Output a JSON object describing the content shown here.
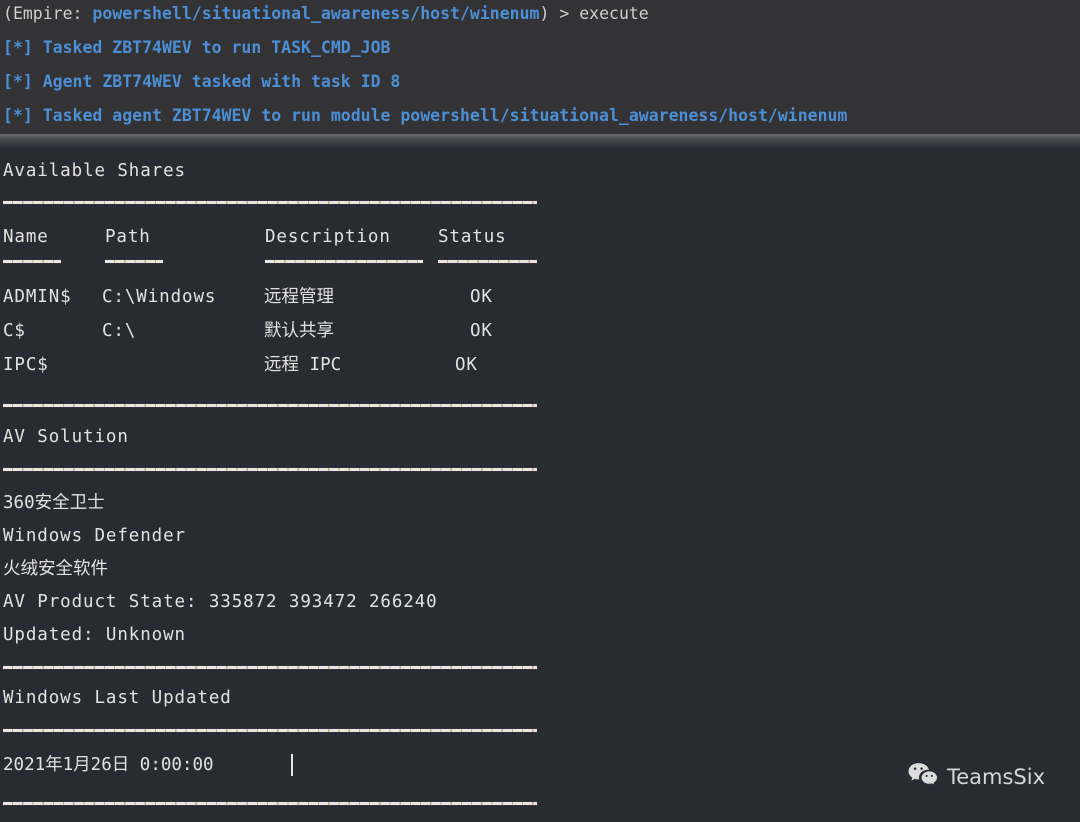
{
  "theme": {
    "header_bg": "#333335",
    "body_bg": "#292b33",
    "text": "#e3e2df",
    "accent_blue": "#4d8fd6",
    "rule": "#e8e6e2"
  },
  "console": {
    "prompt": {
      "open_paren": "(",
      "label": "Empire: ",
      "module_path": "powershell/situational_awareness/host/winenum",
      "close_paren": ")",
      "arrow": " > ",
      "command": "execute"
    },
    "lines": [
      {
        "marker": "[*]",
        "text": " Tasked ZBT74WEV to run TASK_CMD_JOB"
      },
      {
        "marker": "[*]",
        "text": " Agent ZBT74WEV tasked with task ID 8"
      },
      {
        "marker": "[*]",
        "text": " Tasked agent ZBT74WEV to run module powershell/situational_awareness/host/winenum"
      }
    ]
  },
  "output": {
    "shares_section": {
      "title": "Available Shares",
      "columns": [
        "Name",
        "Path",
        "Description",
        "Status"
      ],
      "rows": [
        {
          "name": "ADMIN$",
          "path": "C:\\Windows",
          "description": "远程管理",
          "status": "OK"
        },
        {
          "name": "C$",
          "path": "C:\\",
          "description": "默认共享",
          "status": "OK"
        },
        {
          "name": "IPC$",
          "path": "",
          "description": "远程 IPC",
          "status": "OK"
        }
      ]
    },
    "av_section": {
      "title": "AV Solution",
      "lines": [
        "360安全卫士",
        "Windows Defender",
        "火绒安全软件",
        "AV Product State: 335872 393472 266240",
        "Updated: Unknown"
      ]
    },
    "update_section": {
      "title": "Windows Last Updated",
      "value": "2021年1月26日 0:00:00"
    }
  },
  "watermark": {
    "icon": "wechat-icon",
    "label": "TeamsSix"
  }
}
